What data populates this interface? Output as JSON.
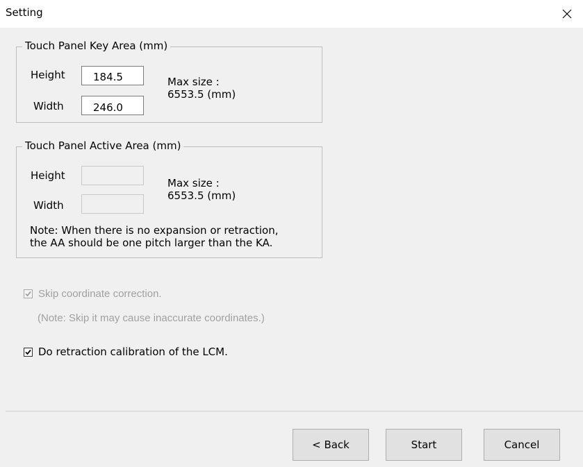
{
  "window": {
    "title": "Setting"
  },
  "key_area": {
    "legend": "Touch Panel Key Area (mm)",
    "height_label": "Height",
    "height_value": "184.5",
    "width_label": "Width",
    "width_value": "246.0",
    "max_label": "Max size :",
    "max_value": "6553.5 (mm)"
  },
  "active_area": {
    "legend": "Touch Panel Active Area (mm)",
    "height_label": "Height",
    "height_value": "",
    "width_label": "Width",
    "width_value": "",
    "max_label": "Max size :",
    "max_value": "6553.5 (mm)",
    "note_line1": "Note: When there is no expansion or retraction,",
    "note_line2": "the AA should be one pitch larger than the KA."
  },
  "options": {
    "skip_correction": {
      "label": "Skip coordinate correction.",
      "checked": true,
      "enabled": false
    },
    "skip_note": "(Note: Skip it may cause inaccurate coordinates.)",
    "retraction": {
      "label": "Do retraction calibration of the LCM.",
      "checked": true,
      "enabled": true
    }
  },
  "buttons": {
    "back": "< Back",
    "start": "Start",
    "cancel": "Cancel"
  },
  "icons": {
    "close": "close-icon",
    "check": "checkmark-icon"
  },
  "colors": {
    "background": "#f0f0f0",
    "titlebar": "#ffffff",
    "disabled_text": "#a0a0a0",
    "group_border": "#bdbdbd"
  }
}
